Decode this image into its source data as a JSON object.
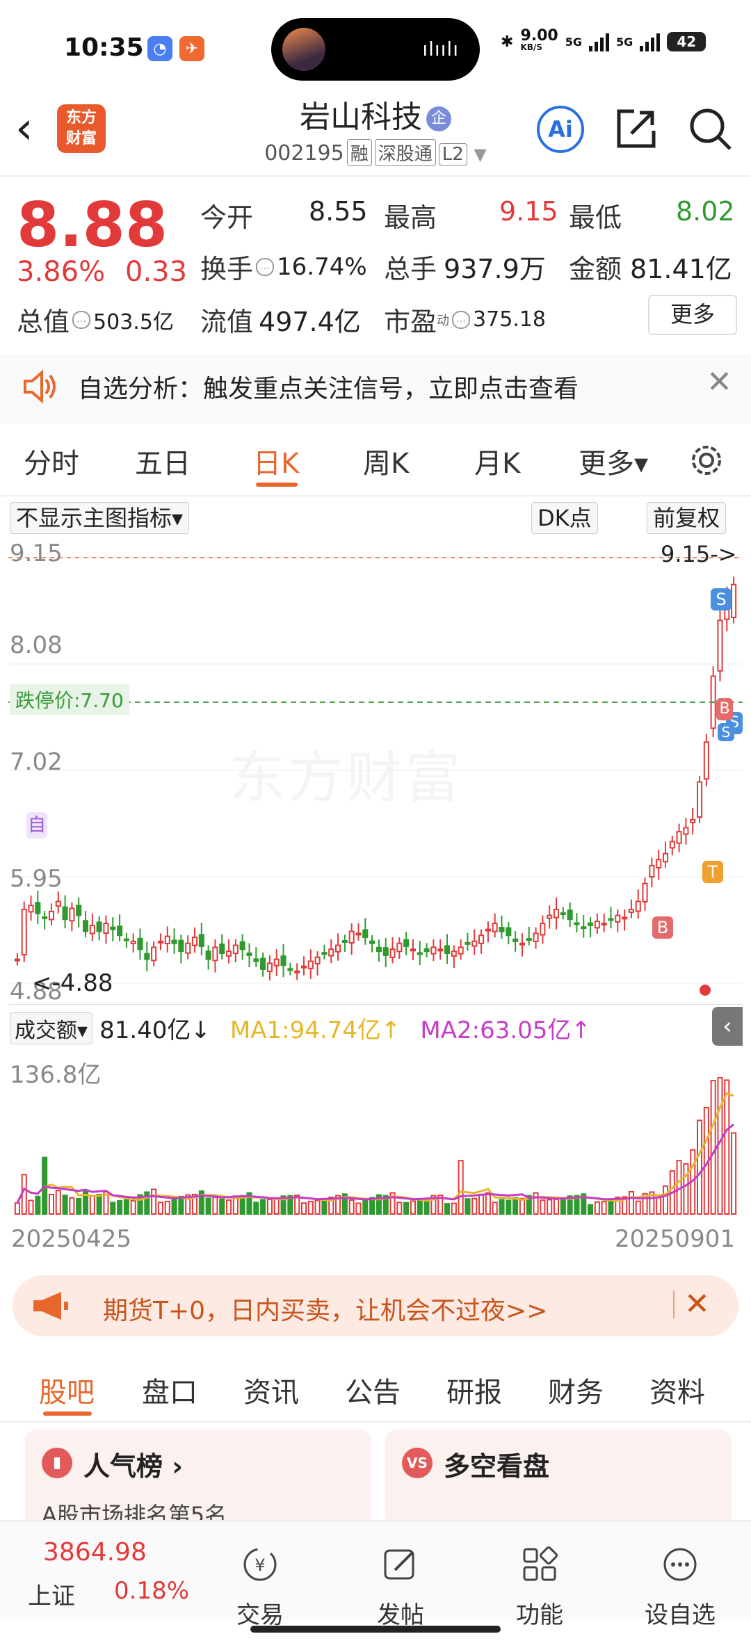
{
  "status_bar": {
    "time": "10:35",
    "net_speed": "9.00",
    "net_unit": "KB/S",
    "signal1": "5G",
    "signal2": "5G",
    "battery": "42"
  },
  "header": {
    "back_icon": "chevron-left-icon",
    "logo_text": [
      "东方",
      "财富"
    ],
    "stock_name": "岩山科技",
    "badge": "企",
    "code": "002195",
    "tags": [
      "融",
      "深股通",
      "L2"
    ],
    "ai_label": "Ai"
  },
  "quote": {
    "price": "8.88",
    "change_pct": "3.86%",
    "change": "0.33",
    "open_label": "今开",
    "open": "8.55",
    "high_label": "最高",
    "high": "9.15",
    "low_label": "最低",
    "low": "8.02",
    "turnover_label": "换手",
    "turnover": "16.74%",
    "volume_label": "总手",
    "volume": "937.9万",
    "amount_label": "金额",
    "amount": "81.41亿",
    "mktcap_label": "总值",
    "mktcap": "503.5亿",
    "float_label": "流值",
    "float_cap": "497.4亿",
    "pe_label": "市盈",
    "pe_sup": "动",
    "pe": "375.18",
    "more_label": "更多"
  },
  "notice": {
    "text": "自选分析：触发重点关注信号，立即点击查看"
  },
  "kline_tabs": [
    "分时",
    "五日",
    "日K",
    "周K",
    "月K",
    "更多▾"
  ],
  "chart_toolbar": {
    "indicator": "不显示主图指标▾",
    "dk": "DK点",
    "adjust": "前复权"
  },
  "chart_data": {
    "type": "candlestick",
    "y_ticks": [
      "9.15",
      "8.08",
      "7.02",
      "5.95",
      "4.88"
    ],
    "ylim": [
      4.88,
      9.15
    ],
    "high_marker": "9.15->",
    "low_marker": "<-4.88",
    "limit_down_label": "跌停价:7.70",
    "limit_down": 7.7,
    "markers": [
      "自",
      "B",
      "S",
      "T",
      "S",
      "B",
      "S"
    ],
    "x_start": "20250425",
    "x_end": "20250901",
    "closes": [
      5.12,
      5.62,
      5.66,
      5.58,
      5.54,
      5.6,
      5.7,
      5.52,
      5.63,
      5.56,
      5.4,
      5.46,
      5.4,
      5.48,
      5.42,
      5.36,
      5.31,
      5.3,
      5.22,
      5.12,
      5.24,
      5.3,
      5.35,
      5.28,
      5.2,
      5.28,
      5.34,
      5.25,
      5.12,
      5.24,
      5.18,
      5.2,
      5.26,
      5.22,
      5.16,
      5.1,
      5.02,
      5.08,
      5.12,
      5.06,
      5.02,
      5.0,
      5.05,
      5.1,
      5.14,
      5.18,
      5.22,
      5.26,
      5.3,
      5.4,
      5.38,
      5.34,
      5.28,
      5.2,
      5.16,
      5.22,
      5.28,
      5.25,
      5.22,
      5.18,
      5.2,
      5.24,
      5.22,
      5.18,
      5.2,
      5.24,
      5.28,
      5.3,
      5.36,
      5.42,
      5.48,
      5.4,
      5.36,
      5.3,
      5.28,
      5.32,
      5.38,
      5.48,
      5.56,
      5.62,
      5.58,
      5.52,
      5.48,
      5.44,
      5.46,
      5.5,
      5.48,
      5.52,
      5.56,
      5.54,
      5.62,
      5.7,
      5.88,
      6.06,
      6.12,
      6.18,
      6.3,
      6.4,
      6.44,
      6.52,
      6.9,
      7.3,
      7.96,
      8.52,
      8.8,
      8.88
    ],
    "volume": {
      "label": "成交额▾",
      "value": "81.40亿↓",
      "ma1": "MA1:94.74亿↑",
      "ma2": "MA2:63.05亿↑",
      "max_label": "136.8亿",
      "max": 136.8
    }
  },
  "ad": {
    "text": "期货T+0，日内买卖，让机会不过夜>>"
  },
  "bottom_tabs": [
    "股吧",
    "盘口",
    "资讯",
    "公告",
    "研报",
    "财务",
    "资料"
  ],
  "cards": {
    "popularity_title": "人气榜 ›",
    "popularity_sub": "A股市场排名第5名",
    "longshort_title": "多空看盘"
  },
  "footer": {
    "index_value": "3864.98",
    "index_name": "上证",
    "index_change": "0.18%",
    "items": [
      "交易",
      "发帖",
      "功能",
      "设自选"
    ]
  },
  "colors": {
    "up": "#e23a3a",
    "down": "#2f9a2f",
    "accent": "#e8672c"
  }
}
